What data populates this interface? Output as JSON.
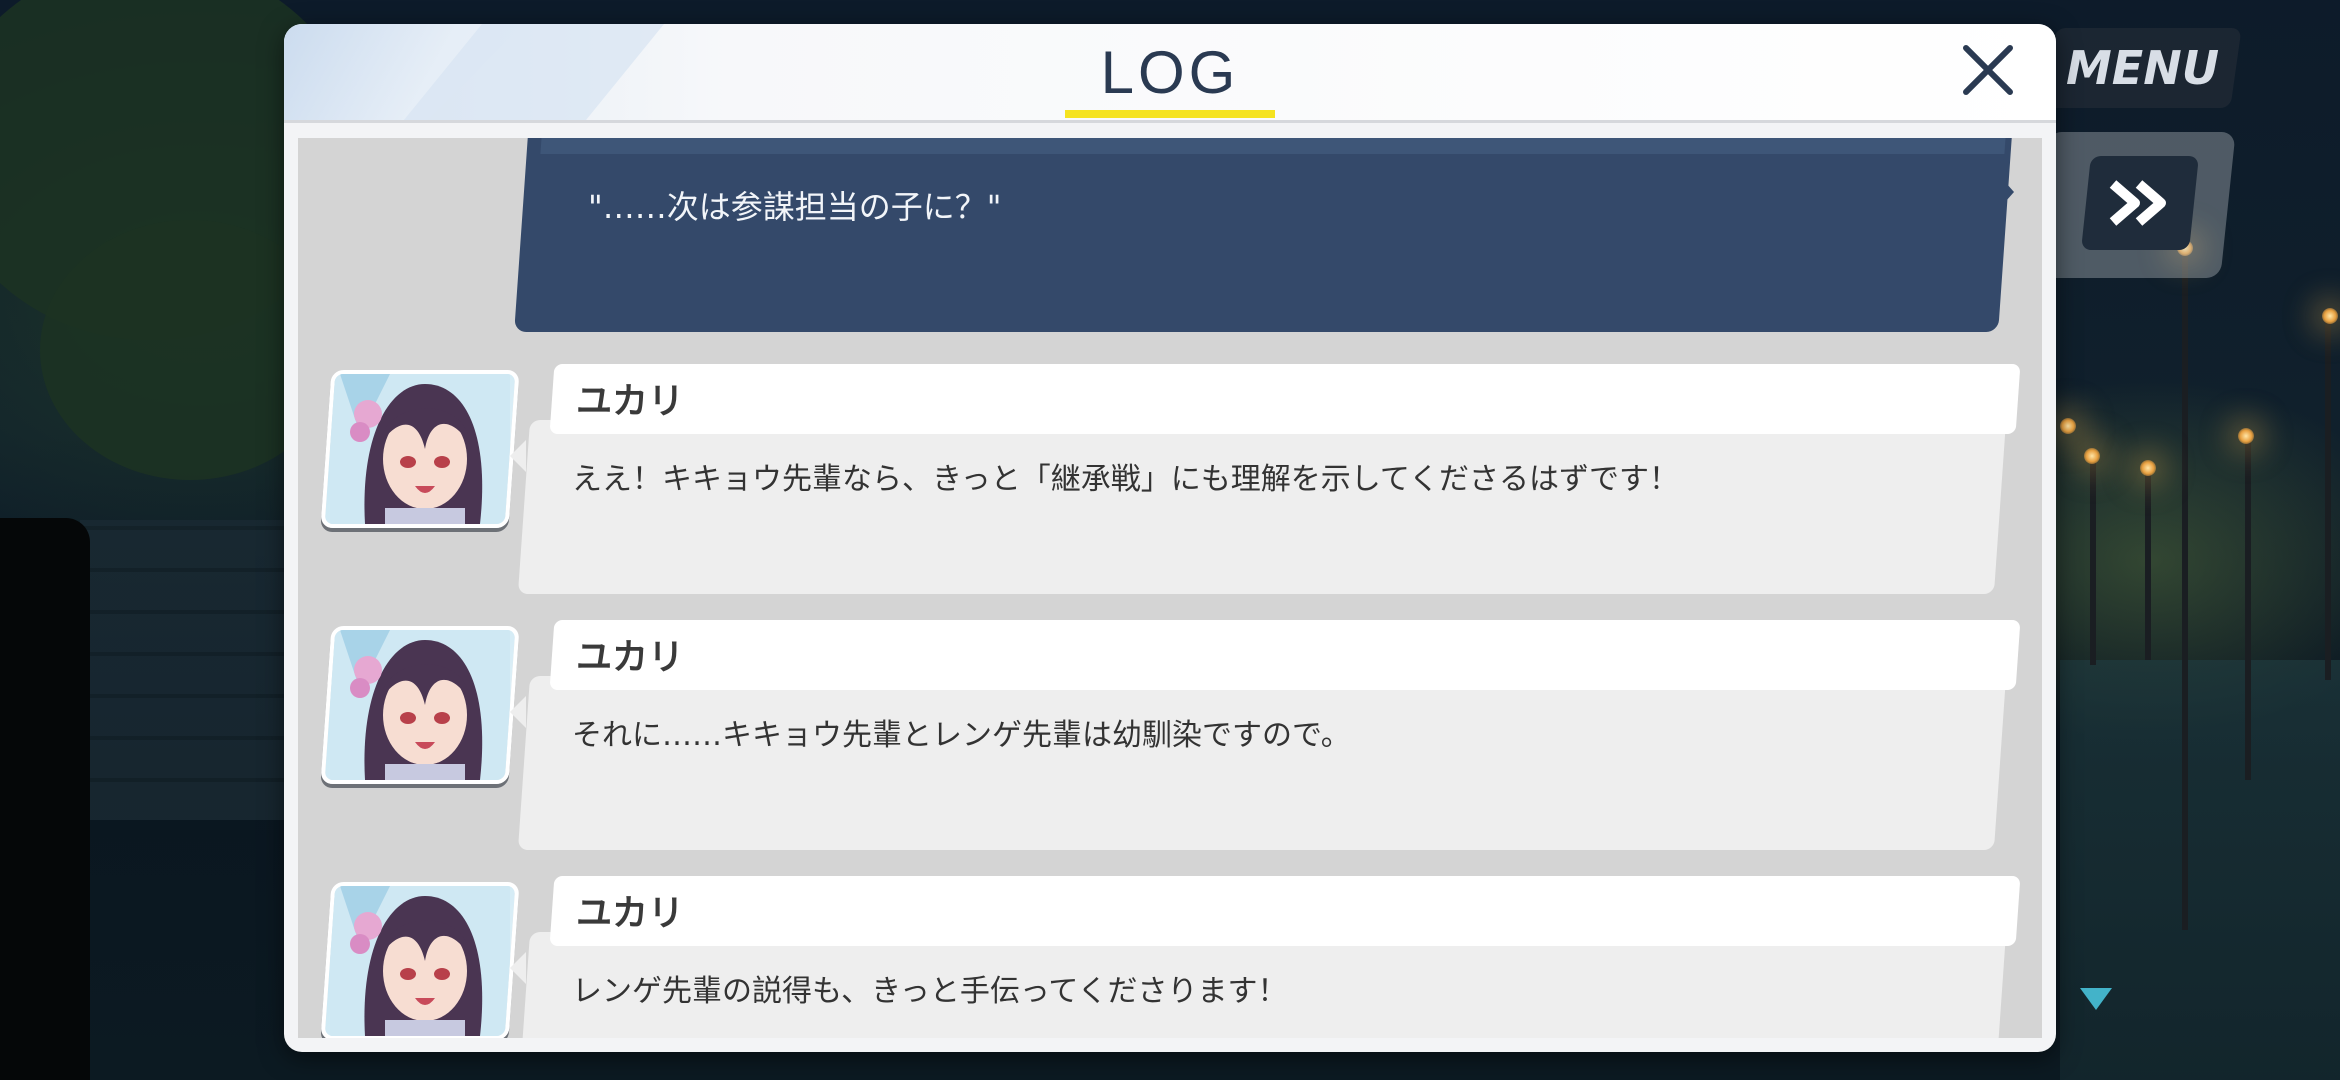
{
  "hud": {
    "menu_label": "MENU",
    "skip_icon": "fast-forward-icon",
    "next_icon": "down-triangle-icon"
  },
  "log": {
    "title": "LOG",
    "close_icon": "close-icon",
    "entries": [
      {
        "speaker": "",
        "text": "\"……次は参謀担当の子に？\"",
        "is_player": true
      },
      {
        "speaker": "ユカリ",
        "text": "ええ！キキョウ先輩なら、きっと「継承戦」にも理解を示してくださるはずです！"
      },
      {
        "speaker": "ユカリ",
        "text": "それに……キキョウ先輩とレンゲ先輩は幼馴染ですので。"
      },
      {
        "speaker": "ユカリ",
        "text": "レンゲ先輩の説得も、きっと手伝ってくださります！"
      }
    ]
  },
  "colors": {
    "title": "#2a3a52",
    "underline": "#f5e320",
    "player_box": "#34496a",
    "message_box": "#eeeeee",
    "accent_arrow": "#43b3c9"
  }
}
